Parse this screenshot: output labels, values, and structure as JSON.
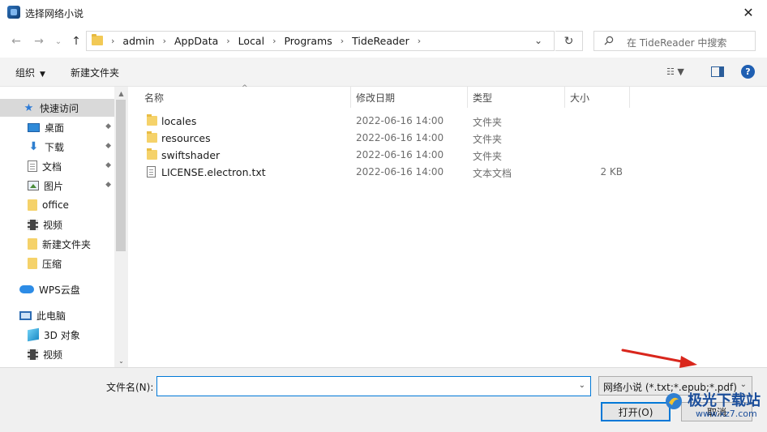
{
  "window": {
    "title": "选择网络小说",
    "close_glyph": "✕"
  },
  "nav": {
    "back_glyph": "←",
    "forward_glyph": "→",
    "recent_glyph": "⌄",
    "up_glyph": "↑",
    "breadcrumbs": [
      "admin",
      "AppData",
      "Local",
      "Programs",
      "TideReader"
    ],
    "sep_glyph": "›",
    "dropdown_glyph": "⌄",
    "refresh_glyph": "↻",
    "search_placeholder": "在 TideReader 中搜索"
  },
  "toolbar": {
    "organize_label": "组织",
    "new_folder_label": "新建文件夹",
    "caret_glyph": "▼",
    "view_glyph": "☷ ▼",
    "help_glyph": "?"
  },
  "sidebar": {
    "items": [
      {
        "label": "快速访问",
        "icon": "star-icon",
        "pinned": false
      },
      {
        "label": "桌面",
        "icon": "desktop-icon",
        "pinned": true
      },
      {
        "label": "下载",
        "icon": "download-icon",
        "pinned": true
      },
      {
        "label": "文档",
        "icon": "document-icon",
        "pinned": true
      },
      {
        "label": "图片",
        "icon": "picture-icon",
        "pinned": true
      },
      {
        "label": "office",
        "icon": "folder-icon",
        "pinned": false
      },
      {
        "label": "视频",
        "icon": "video-icon",
        "pinned": false
      },
      {
        "label": "新建文件夹",
        "icon": "folder-icon",
        "pinned": false
      },
      {
        "label": "压缩",
        "icon": "folder-icon",
        "pinned": false
      },
      {
        "label": "WPS云盘",
        "icon": "cloud-icon",
        "pinned": false
      },
      {
        "label": "此电脑",
        "icon": "pc-icon",
        "pinned": false
      },
      {
        "label": "3D 对象",
        "icon": "3d-objects-icon",
        "pinned": false
      },
      {
        "label": "视频",
        "icon": "video-icon",
        "pinned": false
      }
    ],
    "star_glyph": "★",
    "download_glyph": "⬇",
    "pin_glyph": "📌"
  },
  "filelist": {
    "columns": {
      "name": "名称",
      "date": "修改日期",
      "type": "类型",
      "size": "大小"
    },
    "sort_glyph": "^",
    "rows": [
      {
        "name": "locales",
        "date": "2022-06-16 14:00",
        "type": "文件夹",
        "size": "",
        "kind": "folder"
      },
      {
        "name": "resources",
        "date": "2022-06-16 14:00",
        "type": "文件夹",
        "size": "",
        "kind": "folder"
      },
      {
        "name": "swiftshader",
        "date": "2022-06-16 14:00",
        "type": "文件夹",
        "size": "",
        "kind": "folder"
      },
      {
        "name": "LICENSE.electron.txt",
        "date": "2022-06-16 14:00",
        "type": "文本文档",
        "size": "2 KB",
        "kind": "txt"
      }
    ]
  },
  "bottom": {
    "filename_label": "文件名(N):",
    "filename_value": "",
    "filetype_value": "网络小说 (*.txt;*.epub;*.pdf)",
    "open_label": "打开(O)",
    "cancel_label": "取消",
    "dropdown_glyph": "⌄"
  },
  "watermark": {
    "text": "极光下载站",
    "url": "www.xz7.com"
  },
  "colors": {
    "accent": "#0078d7",
    "selected_bg": "#d9d9d9",
    "arrow": "#d9261c",
    "folder": "#f5d26a"
  }
}
